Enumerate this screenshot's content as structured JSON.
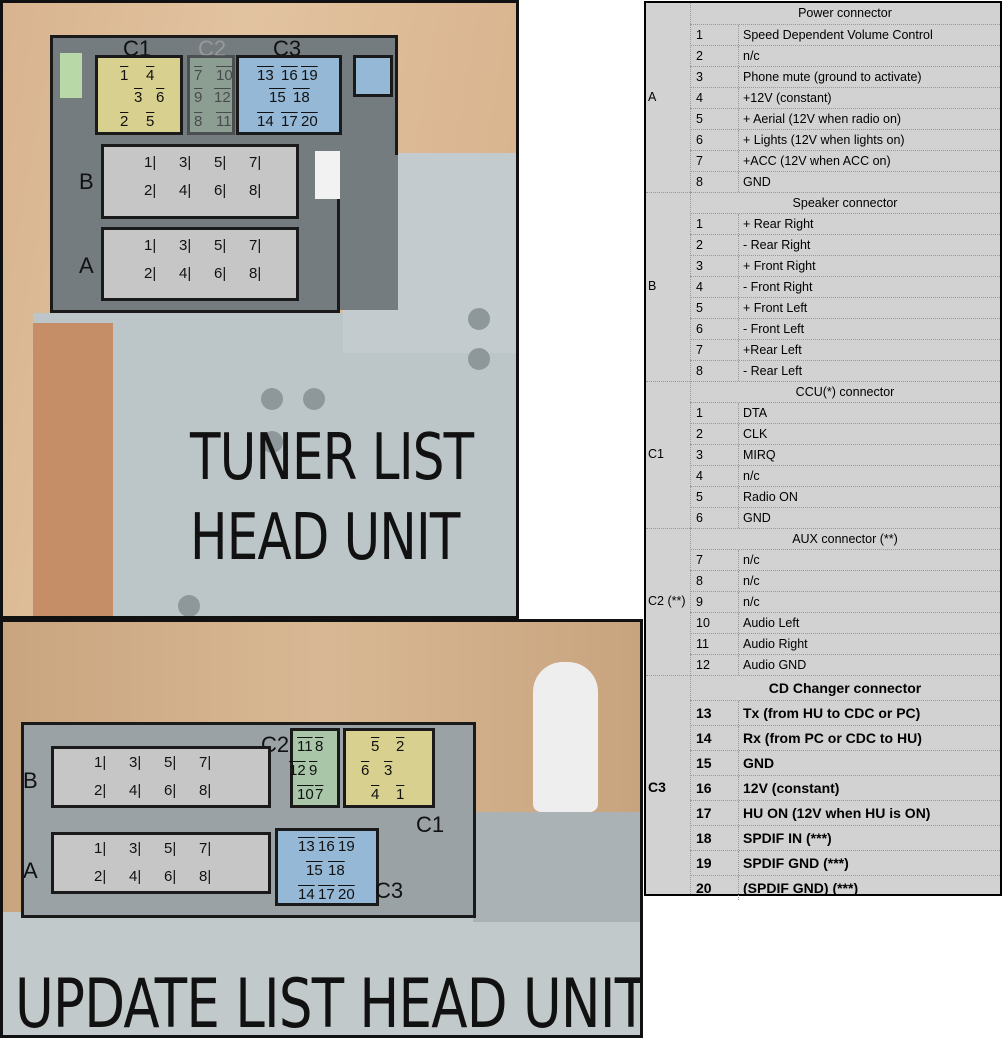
{
  "top_panel": {
    "title_line1": "TUNER LIST",
    "title_line2": "HEAD UNIT",
    "labels": {
      "c1": "C1",
      "c2": "C2",
      "c3": "C3",
      "b": "B",
      "a": "A"
    },
    "c1_pins": [
      "1",
      "4",
      "3",
      "6",
      "2",
      "5"
    ],
    "c2_pins": [
      "7",
      "10",
      "9",
      "12",
      "8",
      "11"
    ],
    "c3_pins": [
      "13",
      "16",
      "19",
      "15",
      "18",
      "14",
      "17",
      "20"
    ],
    "b_pins": [
      "1",
      "3",
      "5",
      "7",
      "2",
      "4",
      "6",
      "8"
    ],
    "a_pins": [
      "1",
      "3",
      "5",
      "7",
      "2",
      "4",
      "6",
      "8"
    ]
  },
  "bottom_panel": {
    "title": "UPDATE LIST HEAD UNIT",
    "labels": {
      "c1": "C1",
      "c2": "C2",
      "c3": "C3",
      "b": "B",
      "a": "A"
    },
    "c1_pins": [
      "5",
      "2",
      "6",
      "3",
      "4",
      "1"
    ],
    "c2_pins": [
      "11",
      "8",
      "12",
      "9",
      "10",
      "7"
    ],
    "c3_pins": [
      "13",
      "16",
      "19",
      "15",
      "18",
      "14",
      "17",
      "20"
    ],
    "b_pins": [
      "1",
      "3",
      "5",
      "7",
      "2",
      "4",
      "6",
      "8"
    ],
    "a_pins": [
      "1",
      "3",
      "5",
      "7",
      "2",
      "4",
      "6",
      "8"
    ]
  },
  "table": {
    "sections": [
      {
        "group": "A",
        "title": "Power  connector",
        "rows": [
          [
            "1",
            "Speed Dependent Volume Control"
          ],
          [
            "2",
            "n/c"
          ],
          [
            "3",
            "Phone mute (ground to activate)"
          ],
          [
            "4",
            "+12V (constant)"
          ],
          [
            "5",
            "+ Aerial (12V when radio on)"
          ],
          [
            "6",
            "+ Lights (12V when lights on)"
          ],
          [
            "7",
            "+ACC (12V when ACC on)"
          ],
          [
            "8",
            "GND"
          ]
        ]
      },
      {
        "group": "B",
        "title": "Speaker connector",
        "rows": [
          [
            "1",
            "+ Rear Right"
          ],
          [
            "2",
            "- Rear Right"
          ],
          [
            "3",
            "+ Front Right"
          ],
          [
            "4",
            "- Front Right"
          ],
          [
            "5",
            "+ Front Left"
          ],
          [
            "6",
            "- Front Left"
          ],
          [
            "7",
            "+Rear Left"
          ],
          [
            "8",
            "- Rear Left"
          ]
        ]
      },
      {
        "group": "C1",
        "title": "CCU(*) connector",
        "rows": [
          [
            "1",
            "DTA"
          ],
          [
            "2",
            "CLK"
          ],
          [
            "3",
            "MIRQ"
          ],
          [
            "4",
            "n/c"
          ],
          [
            "5",
            "Radio ON"
          ],
          [
            "6",
            "GND"
          ]
        ]
      },
      {
        "group": "C2 (**)",
        "title": "AUX connector (**)",
        "rows": [
          [
            "7",
            "n/c"
          ],
          [
            "8",
            "n/c"
          ],
          [
            "9",
            "n/c"
          ],
          [
            "10",
            "Audio Left"
          ],
          [
            "11",
            "Audio Right"
          ],
          [
            "12",
            "Audio GND"
          ]
        ]
      },
      {
        "group": "C3",
        "title": "CD Changer connector",
        "bold": true,
        "rows": [
          [
            "13",
            "Tx (from HU to CDC or PC)"
          ],
          [
            "14",
            "Rx (from PC or CDC to HU)"
          ],
          [
            "15",
            "GND"
          ],
          [
            "16",
            "12V (constant)"
          ],
          [
            "17",
            "HU ON (12V when HU is ON)"
          ],
          [
            "18",
            "SPDIF IN (***)"
          ],
          [
            "19",
            "SPDIF GND (***)"
          ],
          [
            "20",
            "(SPDIF GND) (***)"
          ]
        ]
      }
    ]
  }
}
